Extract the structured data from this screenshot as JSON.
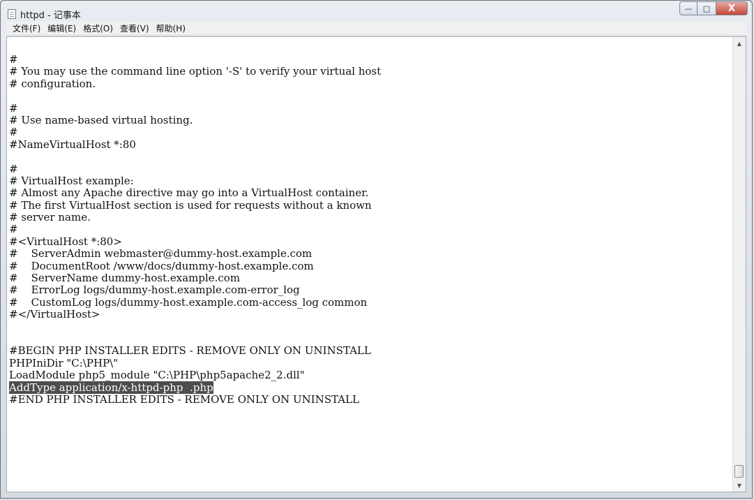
{
  "window": {
    "title": "httpd - 记事本",
    "minimize_glyph": "—",
    "maximize_glyph": "□",
    "close_glyph": "X"
  },
  "menu": [
    "文件(F)",
    "编辑(E)",
    "格式(O)",
    "查看(V)",
    "帮助(H)"
  ],
  "lines": [
    "#",
    "# You may use the command line option '-S' to verify your virtual host",
    "# configuration.",
    "",
    "#",
    "# Use name-based virtual hosting.",
    "#",
    "#NameVirtualHost *:80",
    "",
    "#",
    "# VirtualHost example:",
    "# Almost any Apache directive may go into a VirtualHost container.",
    "# The first VirtualHost section is used for requests without a known",
    "# server name.",
    "#",
    "#<VirtualHost *:80>",
    "#    ServerAdmin webmaster@dummy-host.example.com",
    "#    DocumentRoot /www/docs/dummy-host.example.com",
    "#    ServerName dummy-host.example.com",
    "#    ErrorLog logs/dummy-host.example.com-error_log",
    "#    CustomLog logs/dummy-host.example.com-access_log common",
    "#</VirtualHost>",
    "",
    "",
    "#BEGIN PHP INSTALLER EDITS - REMOVE ONLY ON UNINSTALL",
    "PHPIniDir \"C:\\PHP\\\"",
    "LoadModule php5_module \"C:\\PHP\\php5apache2_2.dll\"",
    "AddType application/x-httpd-php  .php",
    "#END PHP INSTALLER EDITS - REMOVE ONLY ON UNINSTALL"
  ],
  "selected_line_index": 27,
  "scroll": {
    "up_glyph": "▲",
    "down_glyph": "▼"
  }
}
